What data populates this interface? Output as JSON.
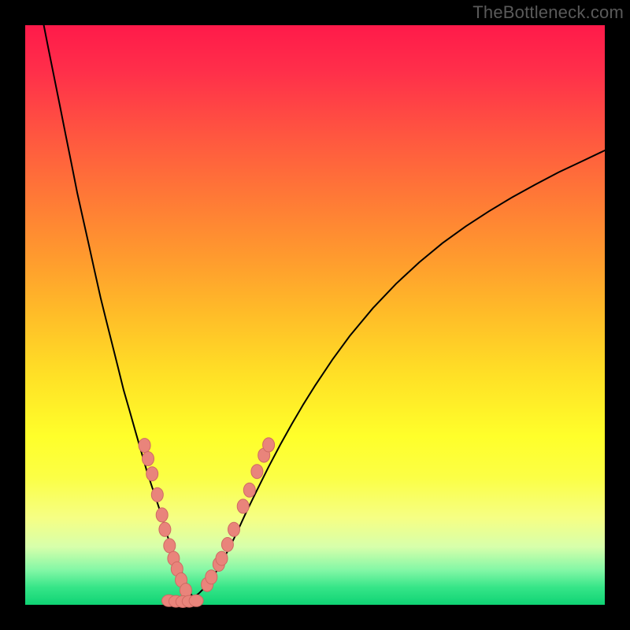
{
  "watermark": "TheBottleneck.com",
  "colors": {
    "curve": "#000000",
    "marker_fill": "#e9847b",
    "marker_stroke": "#cf6a63",
    "background_top": "#ff1a4a",
    "background_bottom": "#0fd374"
  },
  "chart_data": {
    "type": "line",
    "title": "",
    "xlabel": "",
    "ylabel": "",
    "xlim": [
      0,
      100
    ],
    "ylim": [
      0,
      100
    ],
    "left_curve": {
      "x": [
        3.2,
        4,
        5,
        6,
        7,
        8,
        9,
        10,
        11,
        12,
        13,
        14,
        15,
        16,
        17,
        18,
        19,
        20,
        21,
        22,
        23,
        23.8,
        24.5,
        25.2,
        26,
        26.8,
        27.5,
        28,
        28.5,
        29
      ],
      "y": [
        100,
        96,
        91,
        86,
        81,
        76,
        71,
        66.5,
        62,
        57.5,
        53,
        49,
        45,
        41,
        37,
        33.5,
        30,
        26.5,
        23,
        20,
        17,
        14.5,
        12,
        10,
        8,
        6.2,
        4.5,
        3.2,
        2.0,
        1.2
      ]
    },
    "right_curve": {
      "x": [
        29,
        30,
        31,
        32,
        33,
        34,
        35,
        36,
        37,
        38,
        40,
        42,
        44,
        46,
        48,
        50,
        53,
        56,
        60,
        64,
        68,
        72,
        76,
        80,
        84,
        88,
        92,
        96,
        100
      ],
      "y": [
        1.2,
        2.0,
        3.0,
        4.2,
        5.8,
        7.5,
        9.4,
        11.4,
        13.5,
        15.7,
        19.8,
        23.8,
        27.6,
        31.2,
        34.6,
        37.8,
        42.3,
        46.4,
        51.2,
        55.4,
        59.1,
        62.4,
        65.3,
        67.9,
        70.3,
        72.5,
        74.6,
        76.5,
        78.4
      ]
    },
    "bottom_points": [
      {
        "x": 24.8,
        "y": 0.7
      },
      {
        "x": 26.0,
        "y": 0.6
      },
      {
        "x": 27.2,
        "y": 0.55
      },
      {
        "x": 28.3,
        "y": 0.6
      },
      {
        "x": 29.5,
        "y": 0.7
      }
    ],
    "left_markers": [
      {
        "x": 20.6,
        "y": 27.5
      },
      {
        "x": 21.2,
        "y": 25.2
      },
      {
        "x": 21.9,
        "y": 22.6
      },
      {
        "x": 22.8,
        "y": 19.0
      },
      {
        "x": 23.6,
        "y": 15.5
      },
      {
        "x": 24.1,
        "y": 13.0
      },
      {
        "x": 24.9,
        "y": 10.2
      },
      {
        "x": 25.6,
        "y": 8.0
      },
      {
        "x": 26.2,
        "y": 6.2
      },
      {
        "x": 26.9,
        "y": 4.3
      },
      {
        "x": 27.7,
        "y": 2.5
      }
    ],
    "right_markers": [
      {
        "x": 31.4,
        "y": 3.5
      },
      {
        "x": 32.1,
        "y": 4.8
      },
      {
        "x": 33.4,
        "y": 7.0
      },
      {
        "x": 33.9,
        "y": 8.0
      },
      {
        "x": 34.9,
        "y": 10.4
      },
      {
        "x": 36.0,
        "y": 13.0
      },
      {
        "x": 37.6,
        "y": 17.0
      },
      {
        "x": 38.7,
        "y": 19.8
      },
      {
        "x": 40.0,
        "y": 23.0
      },
      {
        "x": 41.2,
        "y": 25.8
      },
      {
        "x": 42.0,
        "y": 27.6
      }
    ]
  }
}
